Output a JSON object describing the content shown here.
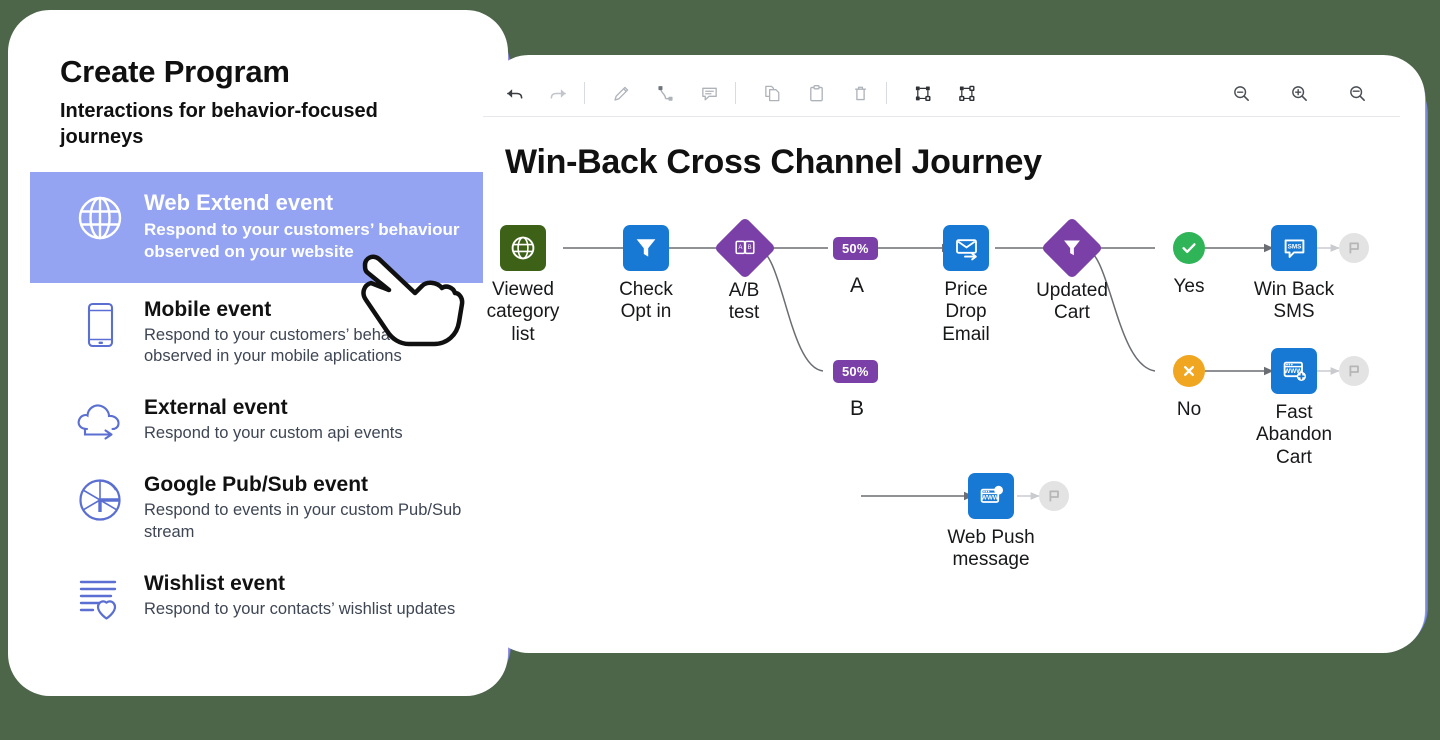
{
  "background_color": "#4d6649",
  "left_panel": {
    "title": "Create Program",
    "subtitle": "Interactions for behavior-focused journeys",
    "selected_index": 0,
    "highlight_color": "#94a4f3",
    "items": [
      {
        "icon": "globe-icon",
        "name": "Web Extend event",
        "description": "Respond to your customers’ behaviour observed on your website",
        "selected": true
      },
      {
        "icon": "mobile-phone-icon",
        "name": "Mobile event",
        "description": "Respond to your customers’ behavior observed in your mobile aplications",
        "selected": false
      },
      {
        "icon": "cloud-arrow-icon",
        "name": "External event",
        "description": "Respond to your custom api events",
        "selected": false
      },
      {
        "icon": "google-pubsub-icon",
        "name": "Google Pub/Sub event",
        "description": "Respond to events in your custom Pub/Sub stream",
        "selected": false
      },
      {
        "icon": "wishlist-heart-icon",
        "name": "Wishlist event",
        "description": "Respond to your contacts’ wishlist updates",
        "selected": false
      }
    ],
    "cursor": "pointing-hand-cursor"
  },
  "right_panel": {
    "toolbar": {
      "groups": [
        [
          {
            "icon": "undo-icon",
            "label": "Undo",
            "enabled": true
          },
          {
            "icon": "redo-icon",
            "label": "Redo",
            "enabled": false
          }
        ],
        [
          {
            "icon": "pencil-edit-icon",
            "label": "Edit",
            "enabled": true
          },
          {
            "icon": "connector-icon",
            "label": "Connect",
            "enabled": true
          },
          {
            "icon": "comment-icon",
            "label": "Comment",
            "enabled": true
          }
        ],
        [
          {
            "icon": "copy-icon",
            "label": "Copy",
            "enabled": true
          },
          {
            "icon": "paste-icon",
            "label": "Paste",
            "enabled": true
          },
          {
            "icon": "trash-icon",
            "label": "Delete",
            "enabled": true
          }
        ],
        [
          {
            "icon": "auto-layout-horizontal-icon",
            "label": "Auto layout",
            "enabled": true
          },
          {
            "icon": "auto-layout-vertical-icon",
            "label": "Align nodes",
            "enabled": true
          }
        ]
      ],
      "zoom_controls": [
        {
          "icon": "zoom-out-icon",
          "label": "Zoom out"
        },
        {
          "icon": "zoom-in-icon",
          "label": "Zoom in"
        },
        {
          "icon": "zoom-reset-icon",
          "label": "Reset zoom"
        }
      ]
    },
    "journey": {
      "title": "Win-Back Cross Channel Journey",
      "colors": {
        "entry_green": "#3d6117",
        "channel_blue": "#1779d4",
        "decision_purple": "#7b3fa8",
        "yes_green": "#2fb457",
        "no_orange": "#f0a621",
        "end_gray": "#e3e3e3",
        "badge_purple": "#7b3fa8"
      },
      "nodes": [
        {
          "id": "viewed-category-list",
          "label": "Viewed\ncategory\nlist",
          "shape": "square",
          "color": "#3d6117",
          "icon": "globe-icon"
        },
        {
          "id": "check-opt-in",
          "label": "Check\nOpt in",
          "shape": "square",
          "color": "#1779d4",
          "icon": "filter-icon"
        },
        {
          "id": "ab-test",
          "label": "A/B\ntest",
          "shape": "diamond",
          "color": "#7b3fa8",
          "icon": "ab-split-icon"
        },
        {
          "id": "price-drop-email",
          "label": "Price\nDrop\nEmail",
          "shape": "square",
          "color": "#1779d4",
          "icon": "email-send-icon"
        },
        {
          "id": "updated-cart",
          "label": "Updated\nCart",
          "shape": "diamond",
          "color": "#7b3fa8",
          "icon": "filter-icon"
        },
        {
          "id": "yes-branch",
          "label": "Yes",
          "shape": "circle",
          "color": "#2fb457",
          "icon": "check-icon"
        },
        {
          "id": "no-branch",
          "label": "No",
          "shape": "circle",
          "color": "#f0a621",
          "icon": "close-x-icon"
        },
        {
          "id": "win-back-sms",
          "label": "Win Back\nSMS",
          "shape": "square",
          "color": "#1779d4",
          "icon": "sms-icon"
        },
        {
          "id": "fast-abandon-cart",
          "label": "Fast\nAbandon\nCart",
          "shape": "square",
          "color": "#1779d4",
          "icon": "web-page-plus-icon"
        },
        {
          "id": "web-push-message",
          "label": "Web Push\nmessage",
          "shape": "square",
          "color": "#1779d4",
          "icon": "web-push-icon"
        }
      ],
      "branch_badges": [
        {
          "id": "branch-a-pct",
          "value": "50%",
          "letter": "A"
        },
        {
          "id": "branch-b-pct",
          "value": "50%",
          "letter": "B"
        }
      ],
      "end_nodes": [
        {
          "id": "end-sms",
          "icon": "flag-end-icon"
        },
        {
          "id": "end-abandon",
          "icon": "flag-end-icon"
        },
        {
          "id": "end-webpush",
          "icon": "flag-end-icon"
        }
      ]
    }
  }
}
